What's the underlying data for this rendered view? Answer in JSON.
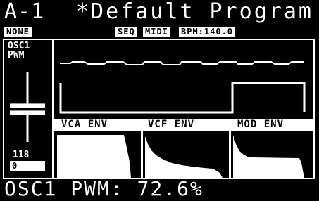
{
  "header": {
    "patch_id": "A-1",
    "program_name": "*Default Program"
  },
  "status": {
    "mode": "NONE",
    "seq": "SEQ",
    "midi": "MIDI",
    "bpm": "BPM:140.0"
  },
  "slider": {
    "title": "OSC1\nPWM",
    "value": "118",
    "box_value": "0",
    "level": 0.46
  },
  "envelopes": {
    "vca_label": "VCA ENV",
    "vcf_label": "VCF ENV",
    "mod_label": "MOD ENV"
  },
  "readout": {
    "text": "OSC1 PWM: 72.6%"
  }
}
